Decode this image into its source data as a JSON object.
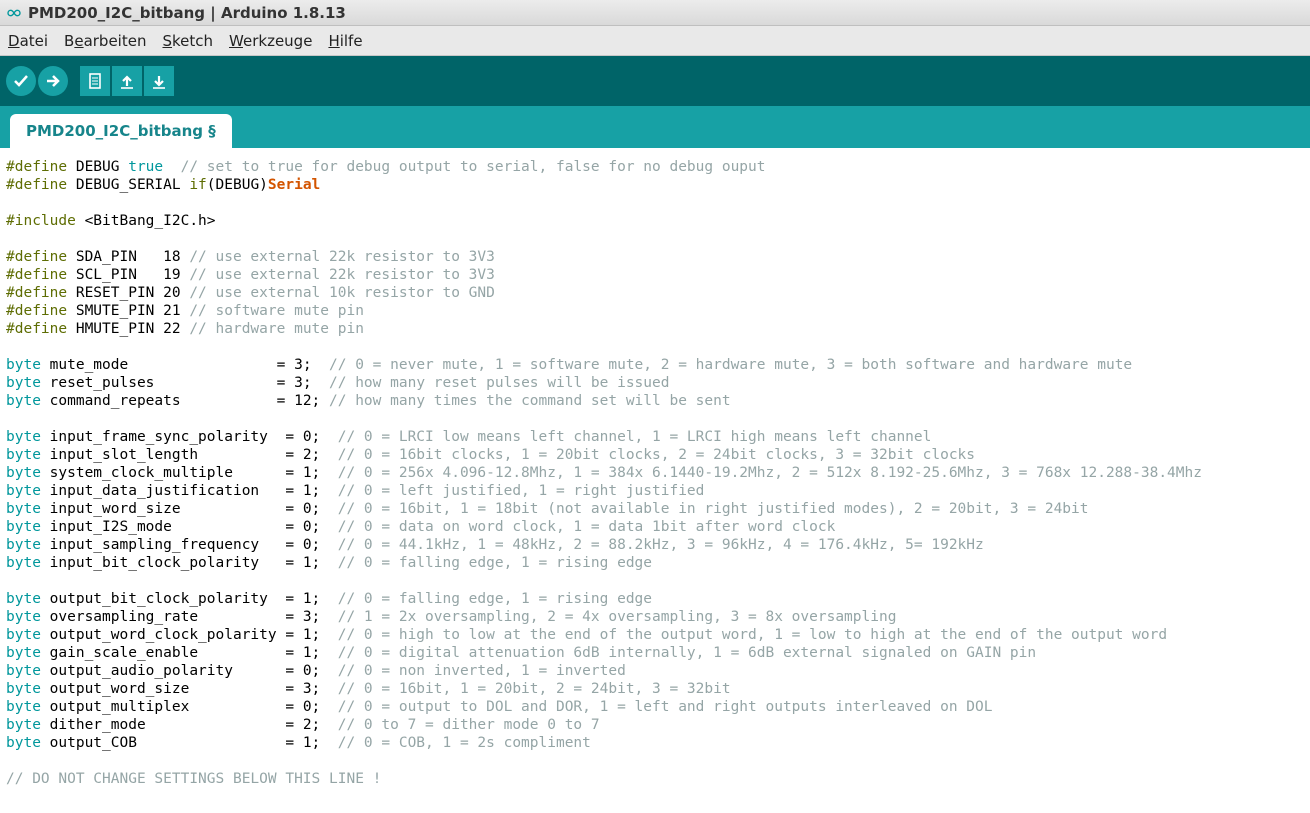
{
  "window": {
    "title": "PMD200_I2C_bitbang | Arduino 1.8.13"
  },
  "menu": {
    "datei": {
      "pre": "",
      "ul": "D",
      "post": "atei"
    },
    "bearbeiten": {
      "pre": "B",
      "ul": "e",
      "post": "arbeiten"
    },
    "sketch": {
      "pre": "",
      "ul": "S",
      "post": "ketch"
    },
    "werkzeuge": {
      "pre": "",
      "ul": "W",
      "post": "erkzeuge"
    },
    "hilfe": {
      "pre": "",
      "ul": "H",
      "post": "ilfe"
    }
  },
  "tabs": {
    "0": {
      "label": "PMD200_I2C_bitbang §"
    }
  },
  "code": {
    "l01": {
      "d": "#define",
      "b": " DEBUG ",
      "v": "true",
      "c": "  // set to true for debug output to serial, false for no debug ouput"
    },
    "l02": {
      "d": "#define",
      "b": " DEBUG_SERIAL ",
      "k": "if",
      "p": "(DEBUG)",
      "s": "Serial"
    },
    "l04": {
      "d": "#include",
      "b": " <BitBang_I2C.h>"
    },
    "l06": {
      "d": "#define",
      "b": " SDA_PIN   18 ",
      "c": "// use external 22k resistor to 3V3"
    },
    "l07": {
      "d": "#define",
      "b": " SCL_PIN   19 ",
      "c": "// use external 22k resistor to 3V3"
    },
    "l08": {
      "d": "#define",
      "b": " RESET_PIN 20 ",
      "c": "// use external 10k resistor to GND"
    },
    "l09": {
      "d": "#define",
      "b": " SMUTE_PIN 21 ",
      "c": "// software mute pin"
    },
    "l10": {
      "d": "#define",
      "b": " HMUTE_PIN 22 ",
      "c": "// hardware mute pin"
    },
    "l12": {
      "t": "byte",
      "b": " mute_mode                 = 3;  ",
      "c": "// 0 = never mute, 1 = software mute, 2 = hardware mute, 3 = both software and hardware mute"
    },
    "l13": {
      "t": "byte",
      "b": " reset_pulses              = 3;  ",
      "c": "// how many reset pulses will be issued"
    },
    "l14": {
      "t": "byte",
      "b": " command_repeats           = 12; ",
      "c": "// how many times the command set will be sent"
    },
    "l16": {
      "t": "byte",
      "b": " input_frame_sync_polarity  = 0;  ",
      "c": "// 0 = LRCI low means left channel, 1 = LRCI high means left channel"
    },
    "l17": {
      "t": "byte",
      "b": " input_slot_length          = 2;  ",
      "c": "// 0 = 16bit clocks, 1 = 20bit clocks, 2 = 24bit clocks, 3 = 32bit clocks"
    },
    "l18": {
      "t": "byte",
      "b": " system_clock_multiple      = 1;  ",
      "c": "// 0 = 256x 4.096-12.8Mhz, 1 = 384x 6.1440-19.2Mhz, 2 = 512x 8.192-25.6Mhz, 3 = 768x 12.288-38.4Mhz"
    },
    "l19": {
      "t": "byte",
      "b": " input_data_justification   = 1;  ",
      "c": "// 0 = left justified, 1 = right justified"
    },
    "l20": {
      "t": "byte",
      "b": " input_word_size            = 0;  ",
      "c": "// 0 = 16bit, 1 = 18bit (not available in right justified modes), 2 = 20bit, 3 = 24bit"
    },
    "l21": {
      "t": "byte",
      "b": " input_I2S_mode             = 0;  ",
      "c": "// 0 = data on word clock, 1 = data 1bit after word clock"
    },
    "l22": {
      "t": "byte",
      "b": " input_sampling_frequency   = 0;  ",
      "c": "// 0 = 44.1kHz, 1 = 48kHz, 2 = 88.2kHz, 3 = 96kHz, 4 = 176.4kHz, 5= 192kHz"
    },
    "l23": {
      "t": "byte",
      "b": " input_bit_clock_polarity   = 1;  ",
      "c": "// 0 = falling edge, 1 = rising edge"
    },
    "l25": {
      "t": "byte",
      "b": " output_bit_clock_polarity  = 1;  ",
      "c": "// 0 = falling edge, 1 = rising edge"
    },
    "l26": {
      "t": "byte",
      "b": " oversampling_rate          = 3;  ",
      "c": "// 1 = 2x oversampling, 2 = 4x oversampling, 3 = 8x oversampling"
    },
    "l27": {
      "t": "byte",
      "b": " output_word_clock_polarity = 1;  ",
      "c": "// 0 = high to low at the end of the output word, 1 = low to high at the end of the output word"
    },
    "l28": {
      "t": "byte",
      "b": " gain_scale_enable          = 1;  ",
      "c": "// 0 = digital attenuation 6dB internally, 1 = 6dB external signaled on GAIN pin"
    },
    "l29": {
      "t": "byte",
      "b": " output_audio_polarity      = 0;  ",
      "c": "// 0 = non inverted, 1 = inverted"
    },
    "l30": {
      "t": "byte",
      "b": " output_word_size           = 3;  ",
      "c": "// 0 = 16bit, 1 = 20bit, 2 = 24bit, 3 = 32bit"
    },
    "l31": {
      "t": "byte",
      "b": " output_multiplex           = 0;  ",
      "c": "// 0 = output to DOL and DOR, 1 = left and right outputs interleaved on DOL"
    },
    "l32": {
      "t": "byte",
      "b": " dither_mode                = 2;  ",
      "c": "// 0 to 7 = dither mode 0 to 7"
    },
    "l33": {
      "t": "byte",
      "b": " output_COB                 = 1;  ",
      "c": "// 0 = COB, 1 = 2s compliment"
    },
    "l35": {
      "c": "// DO NOT CHANGE SETTINGS BELOW THIS LINE !"
    }
  }
}
